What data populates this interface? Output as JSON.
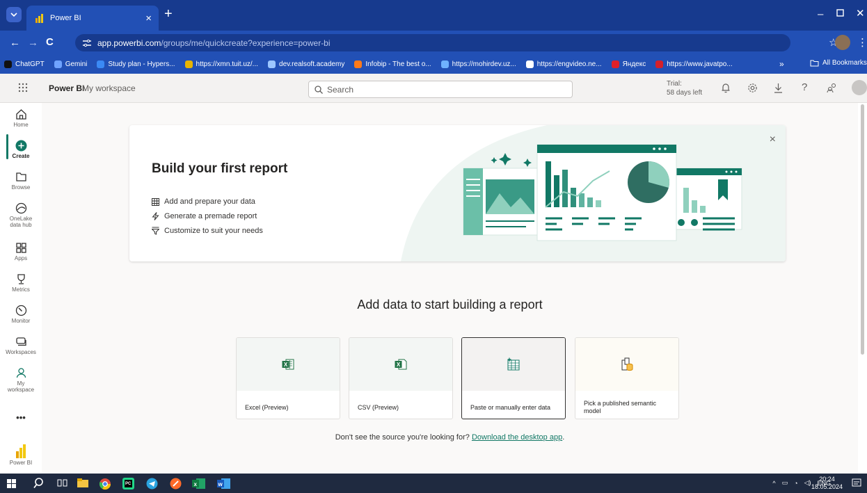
{
  "browser": {
    "tab_title": "Power BI",
    "tab_close": "×",
    "new_tab": "+",
    "url_host": "app.powerbi.com",
    "url_path": "/groups/me/quickcreate?experience=power-bi",
    "bookmarks": [
      "ChatGPT",
      "Gemini",
      "Study plan - Hypers...",
      "https://xmn.tuit.uz/...",
      "dev.realsoft.academy",
      "Infobip - The best o...",
      "https://mohirdev.uz...",
      "https://engvideo.ne...",
      "Яндекс",
      "https://www.javatpo..."
    ],
    "bookmark_colors": [
      "#111111",
      "#6fa3ff",
      "#3b8af5",
      "#e8b400",
      "#9cc6ff",
      "#ff7a1a",
      "#6fb2ff",
      "#ffffff",
      "#e0202a",
      "#d4202a"
    ],
    "more_bookmarks": "»",
    "all_bookmarks": "All Bookmarks"
  },
  "header": {
    "brand": "Power BI",
    "workspace": "My workspace",
    "search_placeholder": "Search",
    "trial_line1": "Trial:",
    "trial_line2": "58 days left"
  },
  "nav": [
    {
      "label": "Home",
      "icon": "home-icon"
    },
    {
      "label": "Create",
      "icon": "create-icon",
      "active": true
    },
    {
      "label": "Browse",
      "icon": "browse-icon"
    },
    {
      "label": "OneLake\ndata hub",
      "icon": "onelake-icon"
    },
    {
      "label": "Apps",
      "icon": "apps-icon"
    },
    {
      "label": "Metrics",
      "icon": "metrics-icon"
    },
    {
      "label": "Monitor",
      "icon": "monitor-icon"
    },
    {
      "label": "Workspaces",
      "icon": "workspaces-icon"
    },
    {
      "label": "My\nworkspace",
      "icon": "my-workspace-icon"
    },
    {
      "label": "•••",
      "icon": "more-icon"
    },
    {
      "label": "Power BI",
      "icon": "powerbi-logo"
    }
  ],
  "banner": {
    "title": "Build your first report",
    "features": [
      "Add and prepare your data",
      "Generate a premade report",
      "Customize to suit your needs"
    ],
    "close": "×"
  },
  "add_data": {
    "title": "Add data to start building a report",
    "cards": [
      {
        "label": "Excel (Preview)",
        "icon": "excel-icon"
      },
      {
        "label": "CSV (Preview)",
        "icon": "csv-icon"
      },
      {
        "label": "Paste or manually enter data",
        "icon": "table-icon",
        "selected": true
      },
      {
        "label": "Pick a published semantic model",
        "icon": "semantic-model-icon"
      }
    ],
    "footnote": "Don't see the source you're looking for?",
    "link": "Download the desktop app",
    "footnote_end": "."
  },
  "taskbar": {
    "lang": "ENG",
    "time": "20:24",
    "date": "18.05.2024"
  },
  "colors": {
    "accent": "#117865",
    "chrome": "#2250b5"
  }
}
